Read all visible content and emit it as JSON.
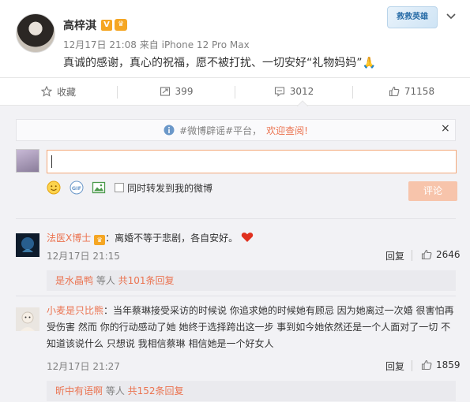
{
  "post": {
    "author": "高梓淇",
    "verified_badge": "V",
    "timestamp": "12月17日 21:08",
    "source_prefix": "来自",
    "source_device": "iPhone 12 Pro Max",
    "text": "真诚的感谢，真心的祝福，愿不被打扰、一切安好“礼物妈妈”🙏",
    "card_badge": "救救英雄"
  },
  "actions": {
    "favorite": "收藏",
    "repost_count": "399",
    "comment_count": "3012",
    "like_count": "71158"
  },
  "notice": {
    "hashtag": "#微博辟谣#平台，",
    "link": "欢迎查阅!",
    "close": "×"
  },
  "composer": {
    "forward_label": "同时转发到我的微博",
    "submit_label": "评论"
  },
  "comments": [
    {
      "name": "法医X博士",
      "separator": "：",
      "text": "离婚不等于悲剧，各自安好。",
      "time": "12月17日 21:15",
      "reply": "回复",
      "likes": "2646",
      "sub_name": "是水晶鸭",
      "sub_mid": " 等人 ",
      "sub_count": "共101条回复"
    },
    {
      "name": "小麦是只比熊",
      "separator": "：",
      "text_line1": "当年蔡琳接受采访的时候说 你追求她的时候她有顾忌 因为她离过一次婚 很害怕再",
      "text_line2": "受伤害 然而 你的行动感动了她 她终于选择跨出这一步 事到如今她依然还是一个人面对了一切 不",
      "text_line3": "知道该说什么 只想说 我相信蔡琳 相信她是一个好女人",
      "time": "12月17日 21:27",
      "reply": "回复",
      "likes": "1859",
      "sub_name": "昕中有语啊",
      "sub_mid": " 等人 ",
      "sub_count": "共152条回复"
    }
  ],
  "colors": {
    "accent": "#eb7350",
    "badge": "#f5a623",
    "panel": "#f2f2f5",
    "heart": "#e0301e"
  }
}
